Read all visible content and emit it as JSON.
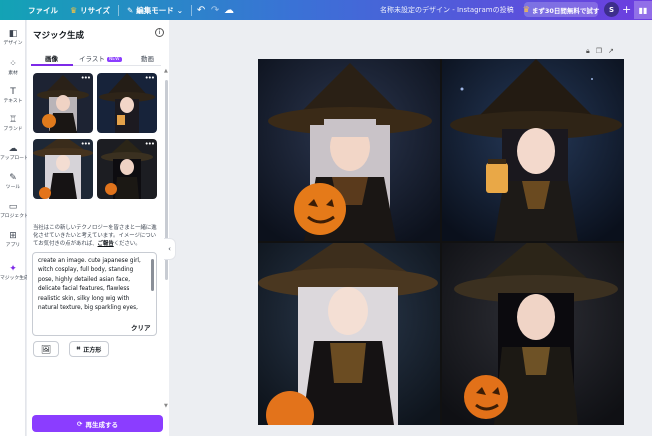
{
  "topbar": {
    "file": "ファイル",
    "resize": "リサイズ",
    "edit_mode": "編集モード",
    "title": "名称未設定のデザイン - Instagramの投稿",
    "trial": "まず30日間無料で試す",
    "avatar_letter": "S"
  },
  "rail": [
    {
      "label": "デザイン",
      "icon": "design-icon"
    },
    {
      "label": "素材",
      "icon": "elements-icon"
    },
    {
      "label": "テキスト",
      "icon": "text-icon"
    },
    {
      "label": "ブランド",
      "icon": "brand-icon"
    },
    {
      "label": "アップロード",
      "icon": "upload-icon"
    },
    {
      "label": "ツール",
      "icon": "draw-icon"
    },
    {
      "label": "プロジェクト",
      "icon": "folder-icon"
    },
    {
      "label": "アプリ",
      "icon": "apps-icon"
    },
    {
      "label": "マジック生成",
      "icon": "magic-icon"
    }
  ],
  "panel": {
    "title": "マジック生成",
    "tabs": {
      "image": "画像",
      "illust": "イラスト",
      "illust_badge": "NEW",
      "video": "動画"
    },
    "disclaimer_text": "当社はこの新しいテクノロジーを皆さまと一緒に進化させていきたいと考えています。イメージについてお気付きの点があれば、",
    "disclaimer_link": "ご報告",
    "disclaimer_end": "ください。",
    "prompt": "create an image. cute japanese girl, witch cosplay, full body, standing pose, highly detailed asian face, delicate facial features, flawless realistic skin, silky long wig with natural texture, big sparkling eyes, natural cosplay makeup, photorealistic, ultra detailed",
    "clear": "クリア",
    "ratio": "正方形",
    "regenerate": "再生成する"
  },
  "colors": {
    "accent": "#8b3dff",
    "topbar_start": "#13a3b5",
    "topbar_end": "#6e3de0"
  }
}
